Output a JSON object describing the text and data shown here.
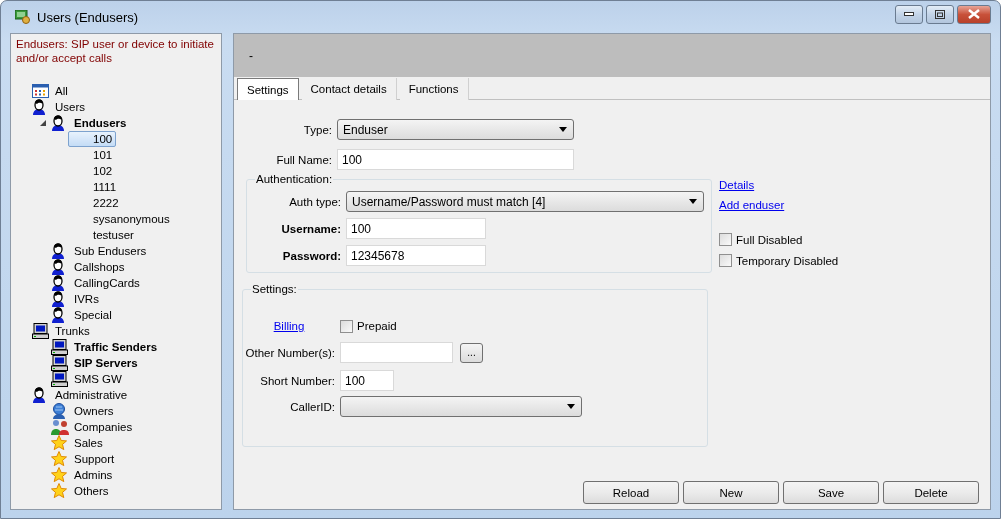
{
  "window": {
    "title": "Users (Endusers)"
  },
  "sidebar": {
    "description": "Endusers: SIP user or device to initiate and/or accept calls",
    "tree": [
      {
        "label": "All",
        "kind": "grid",
        "bold": false,
        "selected": false
      },
      {
        "label": "Users",
        "kind": "person",
        "bold": false,
        "selected": false,
        "children": [
          {
            "label": "Endusers",
            "kind": "person",
            "bold": true,
            "selected": false,
            "expanded": true,
            "children": [
              {
                "label": "100",
                "bold": false,
                "selected": true
              },
              {
                "label": "101",
                "bold": false,
                "selected": false
              },
              {
                "label": "102",
                "bold": false,
                "selected": false
              },
              {
                "label": "1111",
                "bold": false,
                "selected": false
              },
              {
                "label": "2222",
                "bold": false,
                "selected": false
              },
              {
                "label": "sysanonymous",
                "bold": false,
                "selected": false
              },
              {
                "label": "testuser",
                "bold": false,
                "selected": false
              }
            ]
          },
          {
            "label": "Sub Endusers",
            "kind": "person",
            "bold": false,
            "selected": false
          },
          {
            "label": "Callshops",
            "kind": "person",
            "bold": false,
            "selected": false
          },
          {
            "label": "CallingCards",
            "kind": "person",
            "bold": false,
            "selected": false
          },
          {
            "label": "IVRs",
            "kind": "person",
            "bold": false,
            "selected": false
          },
          {
            "label": "Special",
            "kind": "person",
            "bold": false,
            "selected": false
          }
        ]
      },
      {
        "label": "Trunks",
        "kind": "computer",
        "bold": false,
        "selected": false,
        "children": [
          {
            "label": "Traffic Senders",
            "kind": "computer",
            "bold": true,
            "selected": false
          },
          {
            "label": "SIP Servers",
            "kind": "computer",
            "bold": true,
            "selected": false
          },
          {
            "label": "SMS GW",
            "kind": "computer",
            "bold": false,
            "selected": false
          }
        ]
      },
      {
        "label": "Administrative",
        "kind": "person",
        "bold": false,
        "selected": false,
        "children": [
          {
            "label": "Owners",
            "kind": "globe",
            "bold": false,
            "selected": false
          },
          {
            "label": "Companies",
            "kind": "people",
            "bold": false,
            "selected": false
          },
          {
            "label": "Sales",
            "kind": "star",
            "bold": false,
            "selected": false
          },
          {
            "label": "Support",
            "kind": "star",
            "bold": false,
            "selected": false
          },
          {
            "label": "Admins",
            "kind": "star",
            "bold": false,
            "selected": false
          },
          {
            "label": "Others",
            "kind": "star",
            "bold": false,
            "selected": false
          }
        ]
      }
    ]
  },
  "header": {
    "text": "-"
  },
  "tabs": [
    {
      "label": "Settings",
      "selected": true
    },
    {
      "label": "Contact details",
      "selected": false
    },
    {
      "label": "Functions",
      "selected": false
    }
  ],
  "form": {
    "type": {
      "label": "Type:",
      "value": "Enduser"
    },
    "full_name": {
      "label": "Full Name:",
      "value": "100"
    },
    "authentication": {
      "title": "Authentication:",
      "auth_type": {
        "label": "Auth type:",
        "value": "Username/Password must match [4]"
      },
      "username": {
        "label": "Username:",
        "value": "100"
      },
      "password": {
        "label": "Password:",
        "value": "12345678"
      }
    },
    "links": [
      "Details",
      "Add enduser"
    ],
    "flags": [
      {
        "label": "Full Disabled",
        "checked": false
      },
      {
        "label": "Temporary Disabled",
        "checked": false
      }
    ],
    "settings": {
      "title": "Settings:",
      "billing_link": "Billing",
      "prepaid": {
        "label": "Prepaid",
        "checked": false
      },
      "other_numbers": {
        "label": "Other Number(s):",
        "button": "..."
      },
      "short_number": {
        "label": "Short Number:",
        "value": "100"
      },
      "caller_id": {
        "label": "CallerID:"
      }
    }
  },
  "buttons": [
    "Reload",
    "New",
    "Save",
    "Delete"
  ]
}
